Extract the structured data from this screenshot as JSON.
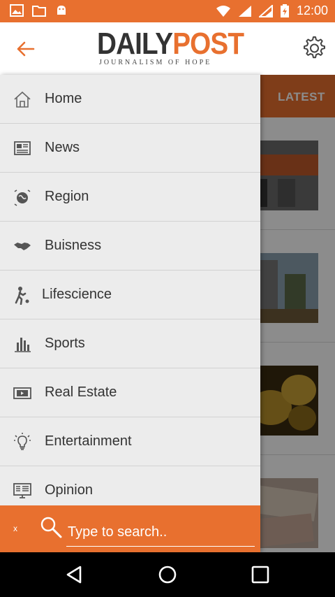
{
  "status_bar": {
    "time": "12:00"
  },
  "header": {
    "logo_primary": "DAILY",
    "logo_accent": "POST",
    "logo_tagline": "JOURNALISM OF HOPE"
  },
  "background": {
    "tab_latest": "LATEST"
  },
  "drawer": {
    "items": [
      {
        "label": "Home",
        "icon": "home-icon"
      },
      {
        "label": "News",
        "icon": "newspaper-icon"
      },
      {
        "label": "Region",
        "icon": "globe-icon"
      },
      {
        "label": "Buisness",
        "icon": "handshake-icon"
      },
      {
        "label": "Lifescience",
        "icon": "running-person-icon"
      },
      {
        "label": "Sports",
        "icon": "bar-chart-icon"
      },
      {
        "label": "Real Estate",
        "icon": "video-icon"
      },
      {
        "label": "Entertainment",
        "icon": "lightbulb-icon"
      },
      {
        "label": "Opinion",
        "icon": "monitor-icon"
      }
    ]
  },
  "search": {
    "close_label": "x",
    "placeholder": "Type to search.."
  },
  "colors": {
    "accent": "#e8702f",
    "drawer_bg": "#ececec"
  }
}
